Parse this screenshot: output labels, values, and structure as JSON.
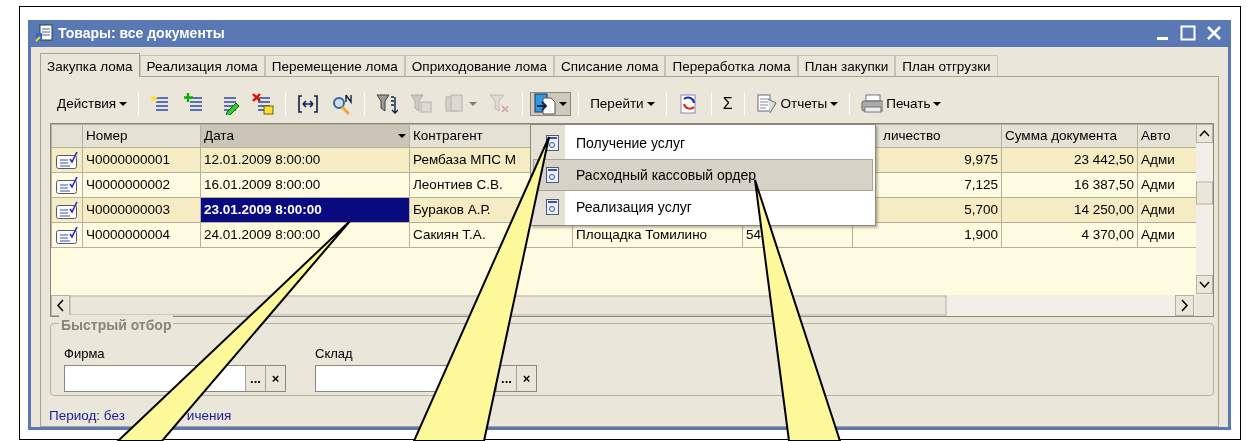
{
  "window": {
    "title": "Товары: все документы"
  },
  "tabs": [
    {
      "label": "Закупка лома",
      "selected": true
    },
    {
      "label": "Реализация лома",
      "selected": false
    },
    {
      "label": "Перемещение лома",
      "selected": false
    },
    {
      "label": "Оприходование лома",
      "selected": false
    },
    {
      "label": "Списание лома",
      "selected": false
    },
    {
      "label": "Переработка лома",
      "selected": false
    },
    {
      "label": "План закупки",
      "selected": false
    },
    {
      "label": "План отгрузки",
      "selected": false
    }
  ],
  "toolbar": [
    {
      "kind": "menu",
      "label": "Действия"
    },
    {
      "kind": "separator"
    },
    {
      "kind": "icon",
      "disabled": false
    },
    {
      "kind": "icon",
      "disabled": false
    },
    {
      "kind": "icon",
      "disabled": false
    },
    {
      "kind": "icon",
      "disabled": false
    },
    {
      "kind": "separator"
    },
    {
      "kind": "icon",
      "disabled": false
    },
    {
      "kind": "icon",
      "disabled": false
    },
    {
      "kind": "separator"
    },
    {
      "kind": "icon",
      "disabled": false
    },
    {
      "kind": "icon",
      "disabled": true
    },
    {
      "kind": "icon_menu",
      "disabled": true,
      "pressed": false
    },
    {
      "kind": "icon",
      "disabled": true
    },
    {
      "kind": "separator"
    },
    {
      "kind": "icon_menu",
      "disabled": false,
      "pressed": true
    },
    {
      "kind": "separator"
    },
    {
      "kind": "menu",
      "label": "Перейти"
    },
    {
      "kind": "separator"
    },
    {
      "kind": "icon",
      "disabled": false
    },
    {
      "kind": "separator"
    },
    {
      "kind": "text",
      "label": "Σ"
    },
    {
      "kind": "separator"
    },
    {
      "kind": "icon_label_menu",
      "label": "Отчеты"
    },
    {
      "kind": "separator"
    },
    {
      "kind": "icon_label_menu",
      "label": "Печать"
    }
  ],
  "table": {
    "columns": [
      {
        "label": "Номер",
        "sorted": false
      },
      {
        "label": "Дата",
        "sorted": true
      },
      {
        "label": "Контрагент",
        "sorted": false
      },
      {},
      {},
      {
        "label": "личество",
        "sorted": false
      },
      {
        "label": "Сумма документа",
        "sorted": false
      },
      {
        "label": "Авто",
        "sorted": false
      }
    ],
    "rows": [
      {
        "selected": false,
        "cells": [
          "Ч0000000001",
          "12.01.2009 8:00:00",
          "Рембаза МПС М",
          null,
          null,
          "9,975",
          "23 442,50",
          "Адми"
        ]
      },
      {
        "selected": false,
        "cells": [
          "Ч0000000002",
          "16.01.2009 8:00:00",
          "Леонтиев С.В.",
          null,
          null,
          "7,125",
          "16 387,50",
          "Адми"
        ]
      },
      {
        "selected": true,
        "cells": [
          "Ч0000000003",
          "23.01.2009 8:00:00",
          "Бураков А.Р.",
          null,
          null,
          "5,700",
          "14 250,00",
          "Адми"
        ]
      },
      {
        "selected": false,
        "cells": [
          "Ч0000000004",
          "24.01.2009 8:00:00",
          "Сакиян Т.А.",
          "Площадка Томилино",
          "54",
          "1,900",
          "4 370,00",
          "Адми"
        ]
      }
    ]
  },
  "dropdown_menu": {
    "items": [
      {
        "label": "Получение услуг",
        "selected": false
      },
      {
        "label": "Расходный кассовый ордер",
        "selected": true
      },
      {
        "label": "Реализация услуг",
        "selected": false
      }
    ]
  },
  "quick_filter": {
    "title": "Быстрый отбор",
    "fields": [
      {
        "label": "Фирма",
        "select_button": "...",
        "clear_button": "×"
      },
      {
        "label": "Склад",
        "select_button": "...",
        "clear_button": "×"
      }
    ]
  },
  "period_link": [
    "Период: без",
    "ичения"
  ],
  "callouts": [
    {
      "kind": "pointer"
    },
    {
      "kind": "pointer"
    },
    {
      "kind": "pointer"
    }
  ]
}
